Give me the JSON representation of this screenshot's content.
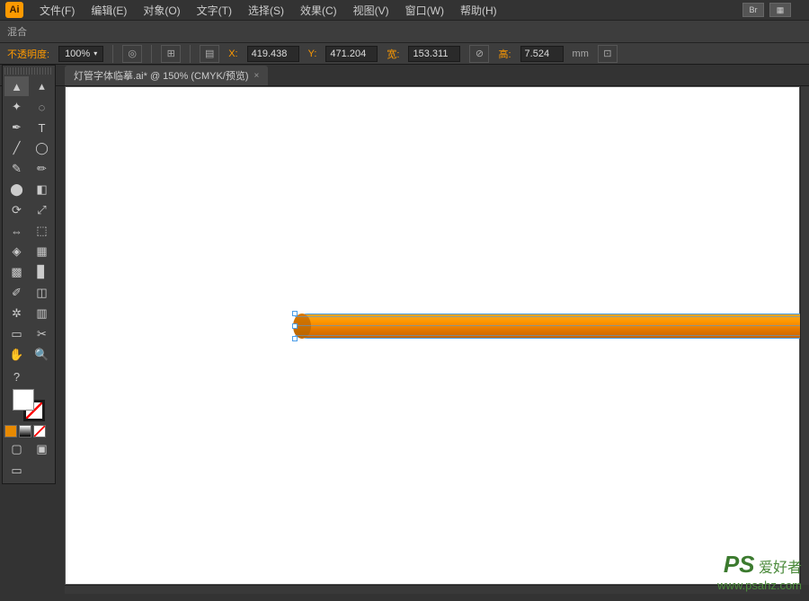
{
  "app": {
    "logo": "Ai"
  },
  "menu": {
    "items": [
      "文件(F)",
      "编辑(E)",
      "对象(O)",
      "文字(T)",
      "选择(S)",
      "效果(C)",
      "视图(V)",
      "窗口(W)",
      "帮助(H)"
    ],
    "br": "Br"
  },
  "options": {
    "blend_mode": "混合",
    "opacity_label": "不透明度:",
    "opacity_value": "100%",
    "x_label": "X:",
    "x_value": "419.438",
    "y_label": "Y:",
    "y_value": "471.204",
    "w_label": "宽:",
    "w_value": "153.311",
    "h_label": "高:",
    "h_value": "7.524",
    "unit": "mm"
  },
  "tab": {
    "title": "灯管字体临摹.ai* @ 150% (CMYK/预览)",
    "close": "×"
  },
  "tools": {
    "help": "?"
  },
  "watermark": {
    "ps": "PS",
    "text": "爱好者",
    "url": "www.psahz.com"
  }
}
